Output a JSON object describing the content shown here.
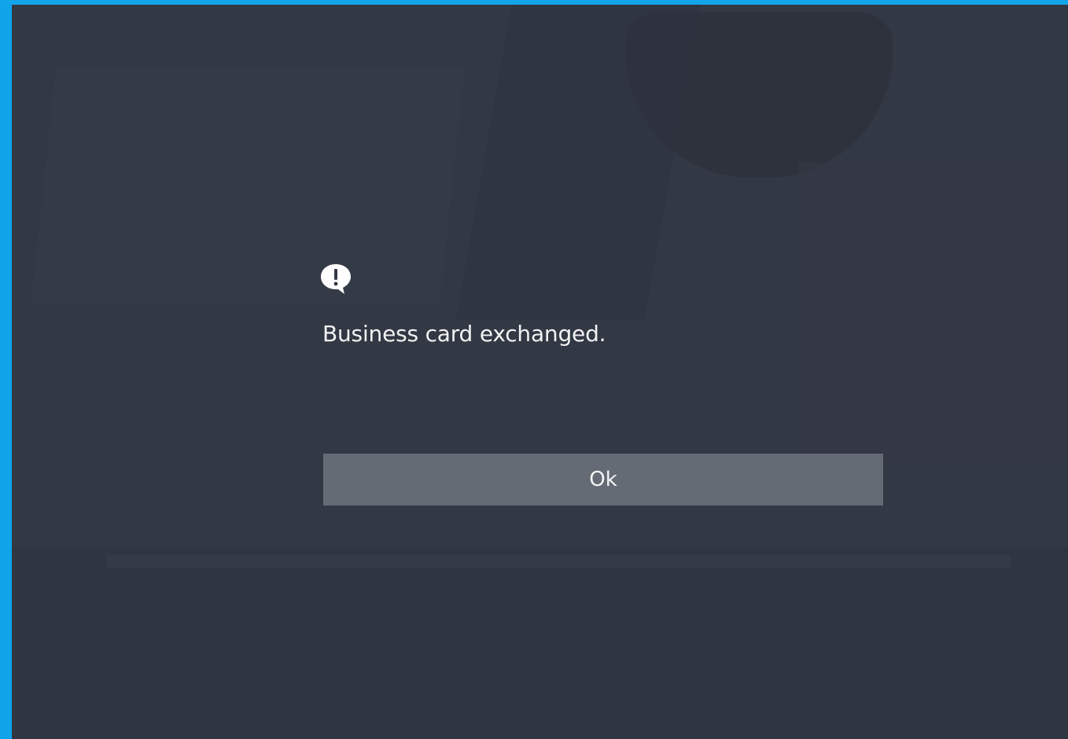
{
  "dialog": {
    "icon": "alert-speech-bubble-icon",
    "message": "Business card exchanged.",
    "ok_label": "Ok"
  },
  "colors": {
    "accent": "#0fa3ea",
    "background": "#323844",
    "button": "#646b75",
    "text": "#f2f2f2"
  }
}
